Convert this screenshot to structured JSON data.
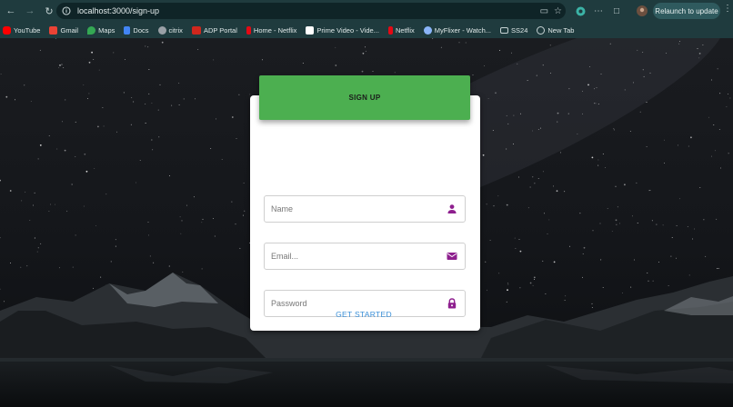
{
  "browser": {
    "url": "localhost:3000/sign-up",
    "relaunch_label": "Relaunch to update"
  },
  "bookmarks": [
    {
      "label": "YouTube",
      "color": "#ff0000"
    },
    {
      "label": "Gmail",
      "color": "#ea4335"
    },
    {
      "label": "Maps",
      "color": "#34a853"
    },
    {
      "label": "Docs",
      "color": "#4285f4"
    },
    {
      "label": "citrix",
      "color": "#9aa0a6"
    },
    {
      "label": "ADP Portal",
      "color": "#d0271d"
    },
    {
      "label": "Home - Netflix",
      "color": "#e50914"
    },
    {
      "label": "Prime Video - Vide...",
      "color": "#ffffff"
    },
    {
      "label": "Netflix",
      "color": "#e50914"
    },
    {
      "label": "MyFlixer - Watch...",
      "color": "#8ab4f8"
    },
    {
      "label": "SS24",
      "color": "#c6d3d4"
    },
    {
      "label": "New Tab",
      "color": "#c6d3d4"
    }
  ],
  "form": {
    "title": "SIGN UP",
    "name_placeholder": "Name",
    "email_placeholder": "Email...",
    "password_placeholder": "Password",
    "submit_label": "GET STARTED"
  },
  "colors": {
    "header": "#4caf50",
    "icon": "#8e1f8e",
    "link": "#3a8fd8"
  }
}
